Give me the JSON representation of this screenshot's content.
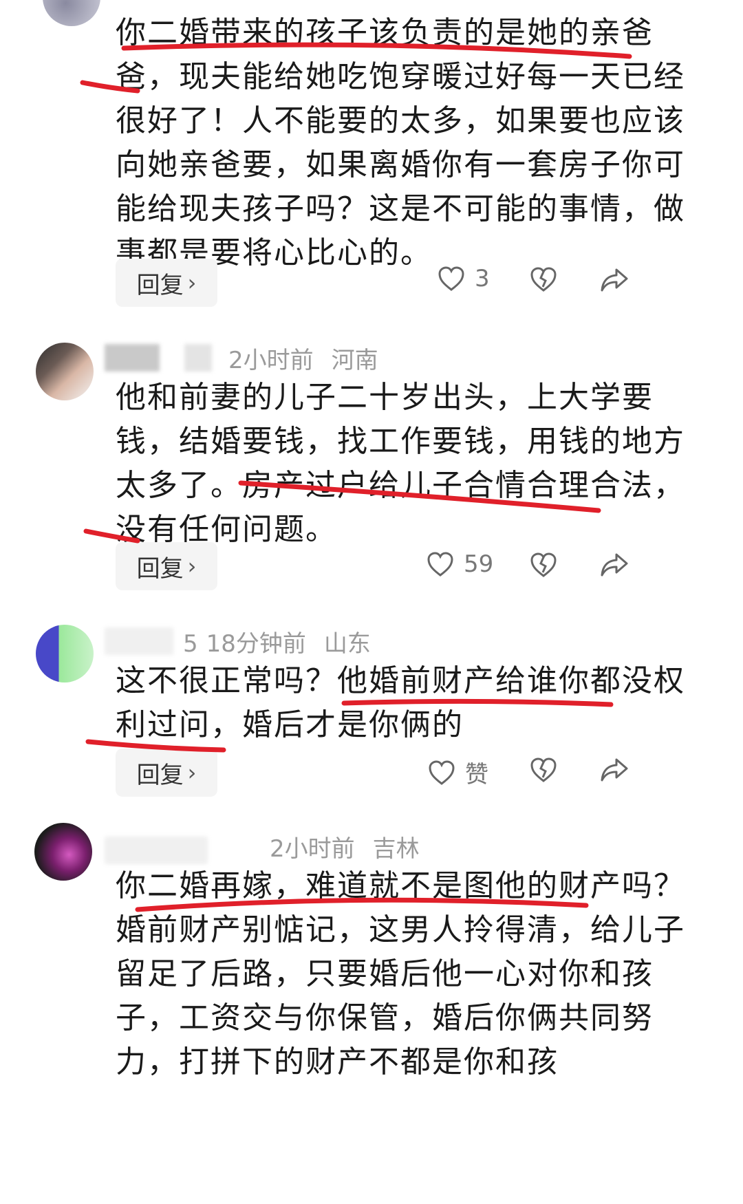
{
  "comments": [
    {
      "body": "你二婚带来的孩子该负责的是她的亲爸爸，现夫能给她吃饱穿暖过好每一天已经很好了！人不能要的太多，如果要也应该向她亲爸要，如果离婚你有一套房子你可能给现夫孩子吗？这是不可能的事情，做事都是要将心比心的。",
      "reply_label": "回复",
      "like_count": "3"
    },
    {
      "time": "2小时前",
      "location": "河南",
      "body": "他和前妻的儿子二十岁出头，上大学要钱，结婚要钱，找工作要钱，用钱的地方太多了。房产过户给儿子合情合理合法，没有任何问题。",
      "reply_label": "回复",
      "like_count": "59"
    },
    {
      "name_fragment": "5",
      "time": "18分钟前",
      "location": "山东",
      "body": "这不很正常吗？他婚前财产给谁你都没权利过问，婚后才是你俩的",
      "reply_label": "回复",
      "like_count": "赞"
    },
    {
      "time": "2小时前",
      "location": "吉林",
      "body": "你二婚再嫁，难道就不是图他的财产吗？婚前财产别惦记，这男人拎得清，给儿子留足了后路，只要婚后他一心对你和孩子，工资交与你保管，婚后你俩共同努力，打拼下的财产不都是你和孩"
    }
  ],
  "annotation_color": "#e0202a",
  "icons": [
    "heart-icon",
    "broken-heart-icon",
    "share-icon",
    "chevron-right-icon"
  ]
}
